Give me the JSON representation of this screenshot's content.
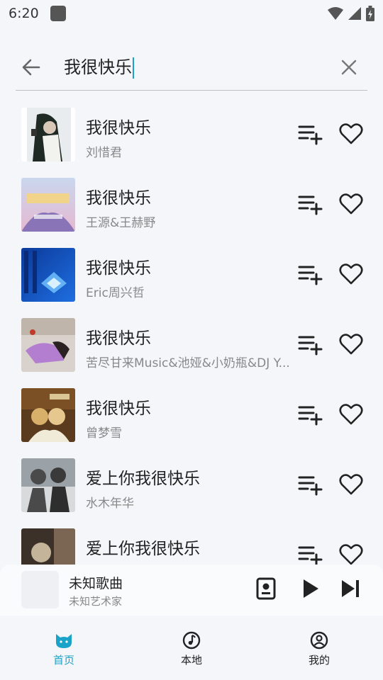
{
  "status_bar": {
    "time": "6:20"
  },
  "search": {
    "query": "我很快乐"
  },
  "songs": [
    {
      "title": "我很快乐",
      "artist": "刘惜君",
      "cover_colors": [
        "#e9ecef",
        "#1f2a24",
        "#f2f2ef"
      ]
    },
    {
      "title": "我很快乐",
      "artist": "王源&王赫野",
      "cover_colors": [
        "#c8d7ee",
        "#8a74b8",
        "#e6b8d0"
      ]
    },
    {
      "title": "我很快乐",
      "artist": "Eric周兴哲",
      "cover_colors": [
        "#0b3a9a",
        "#1f6ee0",
        "#77c6ff"
      ]
    },
    {
      "title": "我很快乐",
      "artist": "苦尽甘来Music&池娅&小奶瓶&DJ Y...",
      "cover_colors": [
        "#d9d2cc",
        "#b47ed0",
        "#2a2222"
      ]
    },
    {
      "title": "我很快乐",
      "artist": "曾梦雪",
      "cover_colors": [
        "#5b3b1e",
        "#d9b06a",
        "#f0ead8"
      ]
    },
    {
      "title": "爱上你我很快乐",
      "artist": "水木年华",
      "cover_colors": [
        "#4a4a4a",
        "#9aa2a8",
        "#d8dadc"
      ]
    },
    {
      "title": "爱上你我很快乐",
      "artist": "",
      "cover_colors": [
        "#3b3128",
        "#7a6652",
        "#c4b49a"
      ]
    }
  ],
  "mini_player": {
    "title": "未知歌曲",
    "artist": "未知艺术家"
  },
  "nav": {
    "items": [
      {
        "label": "首页",
        "active": true,
        "icon": "cat-icon"
      },
      {
        "label": "本地",
        "active": false,
        "icon": "music-note-icon"
      },
      {
        "label": "我的",
        "active": false,
        "icon": "user-circle-icon"
      }
    ]
  },
  "colors": {
    "accent": "#1aa3c8",
    "background": "#f5f6fa",
    "text_secondary": "#888888"
  }
}
